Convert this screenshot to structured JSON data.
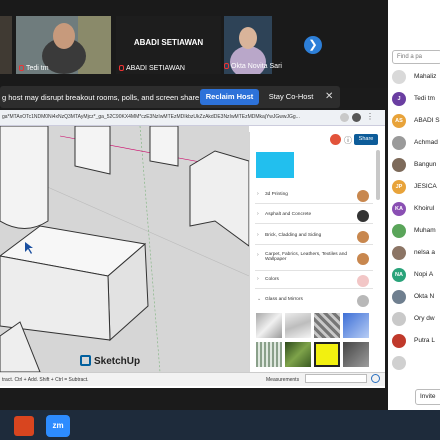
{
  "zoom": {
    "tiles": [
      {
        "name": "Tedi tm"
      },
      {
        "name": "ABADI SETIAWAN",
        "big_name": "ABADI SETIAWAN"
      },
      {
        "name": "Okta Novita Sari"
      }
    ],
    "banner": {
      "message": "g host may disrupt breakout rooms, polls, and screen share",
      "reclaim_label": "Reclaim Host",
      "stay_label": "Stay Co-Host",
      "close": "✕"
    },
    "search_placeholder": "Find a pa",
    "participants": [
      {
        "initials": "",
        "name": "Mahaliz",
        "color": "#d9d9d9"
      },
      {
        "initials": "J",
        "name": "Tedi tm",
        "color": "#6a3ea1"
      },
      {
        "initials": "AS",
        "name": "ABADI S",
        "color": "#e8a33a"
      },
      {
        "initials": "",
        "name": "Achmad",
        "color": "#9a9a9a"
      },
      {
        "initials": "",
        "name": "Bangun",
        "color": "#7d6a5a"
      },
      {
        "initials": "JP",
        "name": "JESICA",
        "color": "#e8a33a"
      },
      {
        "initials": "KA",
        "name": "Khoirul",
        "color": "#8a4fb3"
      },
      {
        "initials": "",
        "name": "Muham",
        "color": "#5aa55a"
      },
      {
        "initials": "",
        "name": "nelsa a",
        "color": "#8c7565"
      },
      {
        "initials": "NA",
        "name": "Nopi A",
        "color": "#29a37a"
      },
      {
        "initials": "",
        "name": "Okta N",
        "color": "#6f7f8f"
      },
      {
        "initials": "",
        "name": "Ory dw",
        "color": "#c9c9c9"
      },
      {
        "initials": "",
        "name": "Putra L",
        "color": "#c0392b"
      },
      {
        "initials": "",
        "name": "",
        "color": "#d0d0d0"
      }
    ],
    "invite_label": "Invite"
  },
  "browser": {
    "url": "ga*MTAxOTc1NDM0Ni4xNzQ3MTAyMjcz*_ga_52C90KX4MM*czE3NzIwMTEzMDIkbzUkZzAkdDE3NzIwMTEzMDMkajYwJGwwJGg..."
  },
  "sketchup": {
    "brand": "SketchUp",
    "share_label": "Share",
    "materials": [
      {
        "label": "3d Printing",
        "color": "#c8874e"
      },
      {
        "label": "Asphalt and Concrete",
        "color": "#333333"
      },
      {
        "label": "Brick, Cladding and Siding",
        "color": "#c8874e"
      },
      {
        "label": "Carpet, Fabrics, Leathers, Textiles and Wallpaper",
        "color": "#c8874e"
      },
      {
        "label": "Colors",
        "color": "#f2c6c6"
      },
      {
        "label": "Glass and Mirrors",
        "color": "#b8b8b8"
      }
    ],
    "status_left": "tract. Ctrl + Add. Shift + Ctrl = Subtract.",
    "measurements_label": "Measurements"
  },
  "taskbar": {
    "zoom_label": "zm"
  }
}
